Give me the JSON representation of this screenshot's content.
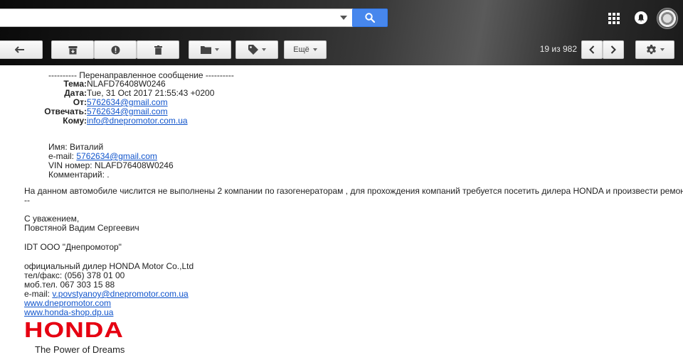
{
  "search": {
    "value": "",
    "placeholder": ""
  },
  "toolbar": {
    "more_label": "Ещё",
    "counter": "19 из 982"
  },
  "icons": {
    "search": "search-icon",
    "apps": "apps-grid-icon",
    "notifications": "bell-icon",
    "back": "back-arrow-icon",
    "archive": "archive-icon",
    "spam": "spam-icon",
    "delete": "trash-icon",
    "move": "folder-icon",
    "labels": "label-icon",
    "prev": "chevron-left-icon",
    "next": "chevron-right-icon",
    "settings": "gear-icon"
  },
  "colors": {
    "search_button": "#4787ed",
    "link": "#1155cc",
    "honda_red": "#e60012"
  },
  "email": {
    "forward_header": "---------- Перенаправленное сообщение ----------",
    "subject_label": "Тема:",
    "subject_value": "NLAFD76408W0246",
    "date_label": "Дата:",
    "date_value": "Tue, 31 Oct 2017 21:55:43 +0200",
    "from_label": "От:",
    "from_value": "5762634@gmail.com",
    "reply_label": "Отвечать:",
    "reply_value": "5762634@gmail.com",
    "to_label": "Кому:",
    "to_value": "info@dnepromotor.com.ua",
    "name_line": "Имя: Виталий",
    "email_label": "e-mail: ",
    "email_value": "5762634@gmail.com",
    "vin_line": "VIN номер: NLAFD76408W0246",
    "comment_line": "Комментарий: .",
    "body_text": "На данном автомобиле числится не выполнены 2 компании по газогенераторам , для прохождения компаний требуется посетить дилера HONDA и произвести ремонт",
    "sig_sep": "--",
    "regards": "С уважением,",
    "sender_name": "Повстяной Вадим Сергеевич",
    "company": "IDT ООО \"Днепромотор\"",
    "dealer": "официальный дилер HONDA Motor Co.,Ltd",
    "phone_fax": "тел/факс: (056) 378 01 00",
    "mobile": "моб.тел. 067 303 15 88",
    "sig_email_label": "e-mail: ",
    "sig_email_value": "v.povstyanoy@dnepromotor.com.ua",
    "website1": "www.dnepromotor.com",
    "website2": "www.honda-shop.dp.ua",
    "logo_word": "HONDA",
    "logo_slogan": "The Power of Dreams"
  }
}
